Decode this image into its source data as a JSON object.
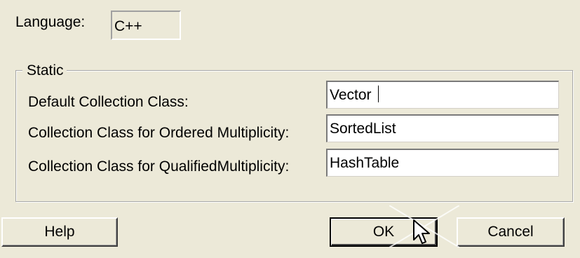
{
  "language": {
    "label": "Language:",
    "value": "C++"
  },
  "static_group": {
    "legend": "Static",
    "rows": [
      {
        "label": "Default Collection Class:",
        "value": "Vector"
      },
      {
        "label": "Collection Class for Ordered Multiplicity:",
        "value": "SortedList"
      },
      {
        "label": "Collection Class for QualifiedMultiplicity:",
        "value": "HashTable"
      }
    ]
  },
  "buttons": {
    "help": "Help",
    "ok": "OK",
    "cancel": "Cancel"
  },
  "icons": {
    "cursor": "mouse-pointer-icon"
  },
  "colors": {
    "dialog_bg": "#ece9d8",
    "field_bg": "#ffffff"
  }
}
